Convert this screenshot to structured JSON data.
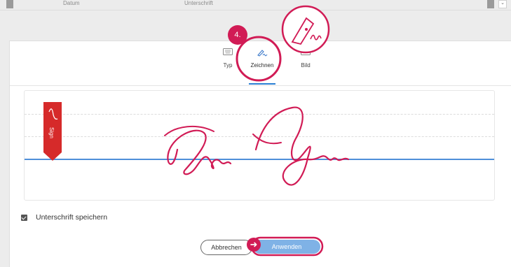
{
  "background_header": {
    "date_label": "Datum",
    "signature_label": "Unterschrift"
  },
  "tabs": [
    {
      "label": "Typ",
      "icon": "keyboard-icon"
    },
    {
      "label": "Zeichnen",
      "icon": "pen-draw-icon"
    },
    {
      "label": "Bild",
      "icon": "image-icon"
    }
  ],
  "annotation": {
    "step_number": "4."
  },
  "sign_flag": {
    "text": "Sign",
    "color": "#d62a2a"
  },
  "save_signature": {
    "label": "Unterschrift speichern",
    "checked": true
  },
  "buttons": {
    "cancel": "Abbrechen",
    "apply": "Anwenden"
  },
  "colors": {
    "highlight": "#d11b55",
    "ink": "#d11b55",
    "baseline": "#4f8fd9",
    "apply_button": "#7fb2e6"
  }
}
